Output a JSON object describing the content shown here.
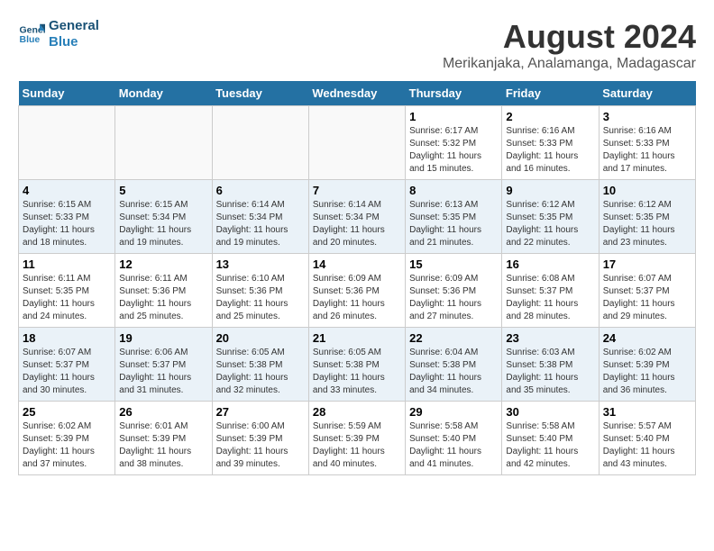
{
  "header": {
    "logo_line1": "General",
    "logo_line2": "Blue",
    "main_title": "August 2024",
    "subtitle": "Merikanjaka, Analamanga, Madagascar"
  },
  "calendar": {
    "days_of_week": [
      "Sunday",
      "Monday",
      "Tuesday",
      "Wednesday",
      "Thursday",
      "Friday",
      "Saturday"
    ],
    "weeks": [
      [
        {
          "day": "",
          "info": ""
        },
        {
          "day": "",
          "info": ""
        },
        {
          "day": "",
          "info": ""
        },
        {
          "day": "",
          "info": ""
        },
        {
          "day": "1",
          "info": "Sunrise: 6:17 AM\nSunset: 5:32 PM\nDaylight: 11 hours and 15 minutes."
        },
        {
          "day": "2",
          "info": "Sunrise: 6:16 AM\nSunset: 5:33 PM\nDaylight: 11 hours and 16 minutes."
        },
        {
          "day": "3",
          "info": "Sunrise: 6:16 AM\nSunset: 5:33 PM\nDaylight: 11 hours and 17 minutes."
        }
      ],
      [
        {
          "day": "4",
          "info": "Sunrise: 6:15 AM\nSunset: 5:33 PM\nDaylight: 11 hours and 18 minutes."
        },
        {
          "day": "5",
          "info": "Sunrise: 6:15 AM\nSunset: 5:34 PM\nDaylight: 11 hours and 19 minutes."
        },
        {
          "day": "6",
          "info": "Sunrise: 6:14 AM\nSunset: 5:34 PM\nDaylight: 11 hours and 19 minutes."
        },
        {
          "day": "7",
          "info": "Sunrise: 6:14 AM\nSunset: 5:34 PM\nDaylight: 11 hours and 20 minutes."
        },
        {
          "day": "8",
          "info": "Sunrise: 6:13 AM\nSunset: 5:35 PM\nDaylight: 11 hours and 21 minutes."
        },
        {
          "day": "9",
          "info": "Sunrise: 6:12 AM\nSunset: 5:35 PM\nDaylight: 11 hours and 22 minutes."
        },
        {
          "day": "10",
          "info": "Sunrise: 6:12 AM\nSunset: 5:35 PM\nDaylight: 11 hours and 23 minutes."
        }
      ],
      [
        {
          "day": "11",
          "info": "Sunrise: 6:11 AM\nSunset: 5:35 PM\nDaylight: 11 hours and 24 minutes."
        },
        {
          "day": "12",
          "info": "Sunrise: 6:11 AM\nSunset: 5:36 PM\nDaylight: 11 hours and 25 minutes."
        },
        {
          "day": "13",
          "info": "Sunrise: 6:10 AM\nSunset: 5:36 PM\nDaylight: 11 hours and 25 minutes."
        },
        {
          "day": "14",
          "info": "Sunrise: 6:09 AM\nSunset: 5:36 PM\nDaylight: 11 hours and 26 minutes."
        },
        {
          "day": "15",
          "info": "Sunrise: 6:09 AM\nSunset: 5:36 PM\nDaylight: 11 hours and 27 minutes."
        },
        {
          "day": "16",
          "info": "Sunrise: 6:08 AM\nSunset: 5:37 PM\nDaylight: 11 hours and 28 minutes."
        },
        {
          "day": "17",
          "info": "Sunrise: 6:07 AM\nSunset: 5:37 PM\nDaylight: 11 hours and 29 minutes."
        }
      ],
      [
        {
          "day": "18",
          "info": "Sunrise: 6:07 AM\nSunset: 5:37 PM\nDaylight: 11 hours and 30 minutes."
        },
        {
          "day": "19",
          "info": "Sunrise: 6:06 AM\nSunset: 5:37 PM\nDaylight: 11 hours and 31 minutes."
        },
        {
          "day": "20",
          "info": "Sunrise: 6:05 AM\nSunset: 5:38 PM\nDaylight: 11 hours and 32 minutes."
        },
        {
          "day": "21",
          "info": "Sunrise: 6:05 AM\nSunset: 5:38 PM\nDaylight: 11 hours and 33 minutes."
        },
        {
          "day": "22",
          "info": "Sunrise: 6:04 AM\nSunset: 5:38 PM\nDaylight: 11 hours and 34 minutes."
        },
        {
          "day": "23",
          "info": "Sunrise: 6:03 AM\nSunset: 5:38 PM\nDaylight: 11 hours and 35 minutes."
        },
        {
          "day": "24",
          "info": "Sunrise: 6:02 AM\nSunset: 5:39 PM\nDaylight: 11 hours and 36 minutes."
        }
      ],
      [
        {
          "day": "25",
          "info": "Sunrise: 6:02 AM\nSunset: 5:39 PM\nDaylight: 11 hours and 37 minutes."
        },
        {
          "day": "26",
          "info": "Sunrise: 6:01 AM\nSunset: 5:39 PM\nDaylight: 11 hours and 38 minutes."
        },
        {
          "day": "27",
          "info": "Sunrise: 6:00 AM\nSunset: 5:39 PM\nDaylight: 11 hours and 39 minutes."
        },
        {
          "day": "28",
          "info": "Sunrise: 5:59 AM\nSunset: 5:39 PM\nDaylight: 11 hours and 40 minutes."
        },
        {
          "day": "29",
          "info": "Sunrise: 5:58 AM\nSunset: 5:40 PM\nDaylight: 11 hours and 41 minutes."
        },
        {
          "day": "30",
          "info": "Sunrise: 5:58 AM\nSunset: 5:40 PM\nDaylight: 11 hours and 42 minutes."
        },
        {
          "day": "31",
          "info": "Sunrise: 5:57 AM\nSunset: 5:40 PM\nDaylight: 11 hours and 43 minutes."
        }
      ]
    ]
  }
}
